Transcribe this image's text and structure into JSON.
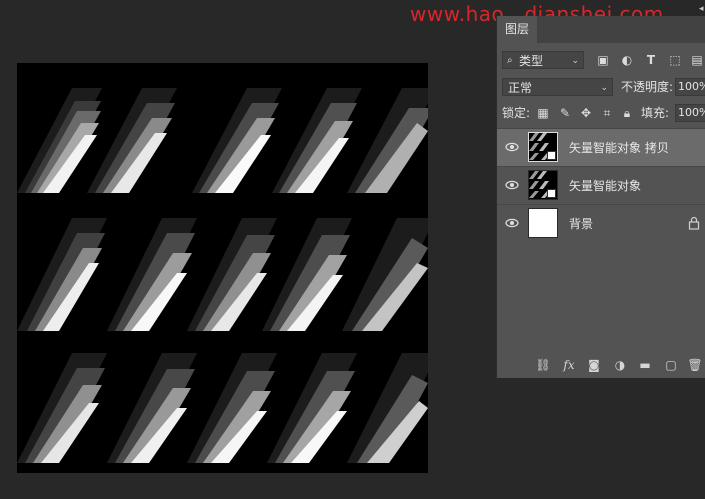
{
  "watermark": "www.hao...dianshej.com",
  "layers_panel": {
    "tab_label": "图层",
    "filter": {
      "kind_label": "类型",
      "icons": [
        "image-filter-icon",
        "adjustment-filter-icon",
        "type-filter-icon",
        "shape-filter-icon",
        "smart-object-filter-icon"
      ]
    },
    "blend_mode": "正常",
    "opacity_label": "不透明度:",
    "opacity_value": "100%",
    "lock_label": "锁定:",
    "fill_label": "填充:",
    "fill_value": "100%",
    "layers": [
      {
        "name": "矢量智能对象 拷贝",
        "visible": true,
        "selected": true,
        "type": "smart-object"
      },
      {
        "name": "矢量智能对象",
        "visible": true,
        "selected": false,
        "type": "smart-object"
      },
      {
        "name": "背景",
        "visible": true,
        "selected": false,
        "type": "background",
        "locked": true
      }
    ],
    "bottom_icons": [
      "link-layers-icon",
      "fx-icon",
      "mask-icon",
      "adjustment-layer-icon",
      "group-folder-icon",
      "new-layer-icon",
      "trash-icon"
    ],
    "fx_label": "fx"
  },
  "colors": {
    "background": "#282828",
    "panel": "#535353",
    "selected_layer": "#6b6b6b",
    "watermark": "#d8262b"
  }
}
